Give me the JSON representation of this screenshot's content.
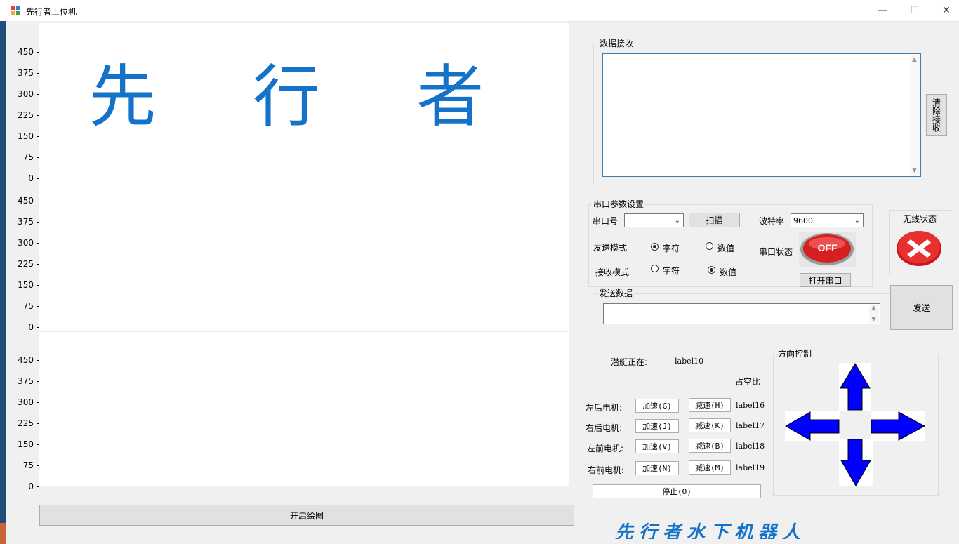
{
  "window": {
    "title": "先行者上位机",
    "minimize": "—",
    "maximize": "☐",
    "close": "✕"
  },
  "chart_data": [
    {
      "type": "line",
      "yticks": [
        "450",
        "375",
        "300",
        "225",
        "150",
        "75",
        "0"
      ],
      "ylim": [
        0,
        450
      ],
      "series": []
    },
    {
      "type": "line",
      "yticks": [
        "450",
        "375",
        "300",
        "225",
        "150",
        "75",
        "0"
      ],
      "ylim": [
        0,
        450
      ],
      "series": []
    },
    {
      "type": "line",
      "yticks": [
        "450",
        "375",
        "300",
        "225",
        "150",
        "75",
        "0"
      ],
      "ylim": [
        0,
        450
      ],
      "series": []
    }
  ],
  "brand": {
    "chars": [
      "先",
      "行",
      "者"
    ],
    "bottom": "先行者水下机器人"
  },
  "buttons": {
    "start_draw": "开启绘图",
    "clear_receive": "清除接收",
    "scan": "扫描",
    "open_port": "打开串口",
    "send": "发送",
    "stop": "停止(O)"
  },
  "receive": {
    "group_label": "数据接收",
    "value": ""
  },
  "serial": {
    "group_label": "串口参数设置",
    "port_label": "串口号",
    "port_value": "",
    "baud_label": "波特率",
    "baud_value": "9600",
    "send_mode_label": "发送模式",
    "recv_mode_label": "接收模式",
    "opt_char": "字符",
    "opt_num": "数值",
    "port_status_label": "串口状态",
    "off_badge": "OFF"
  },
  "wireless": {
    "label": "无线状态"
  },
  "send_data": {
    "group_label": "发送数据",
    "value": ""
  },
  "motors": {
    "sub_status_label": "潜艇正在:",
    "sub_status_value": "label10",
    "duty_label": "占空比",
    "rows": [
      {
        "label": "左后电机:",
        "acc": "加速(G)",
        "dec": "减速(H)",
        "value": "label16"
      },
      {
        "label": "右后电机:",
        "acc": "加速(J)",
        "dec": "减速(K)",
        "value": "label17"
      },
      {
        "label": "左前电机:",
        "acc": "加速(V)",
        "dec": "减速(B)",
        "value": "label18"
      },
      {
        "label": "右前电机:",
        "acc": "加速(N)",
        "dec": "减速(M)",
        "value": "label19"
      }
    ]
  },
  "direction": {
    "group_label": "方向控制"
  },
  "colors": {
    "brand_blue": "#1473c9",
    "arrow_blue": "#0000ff",
    "off_red": "#d42020"
  }
}
